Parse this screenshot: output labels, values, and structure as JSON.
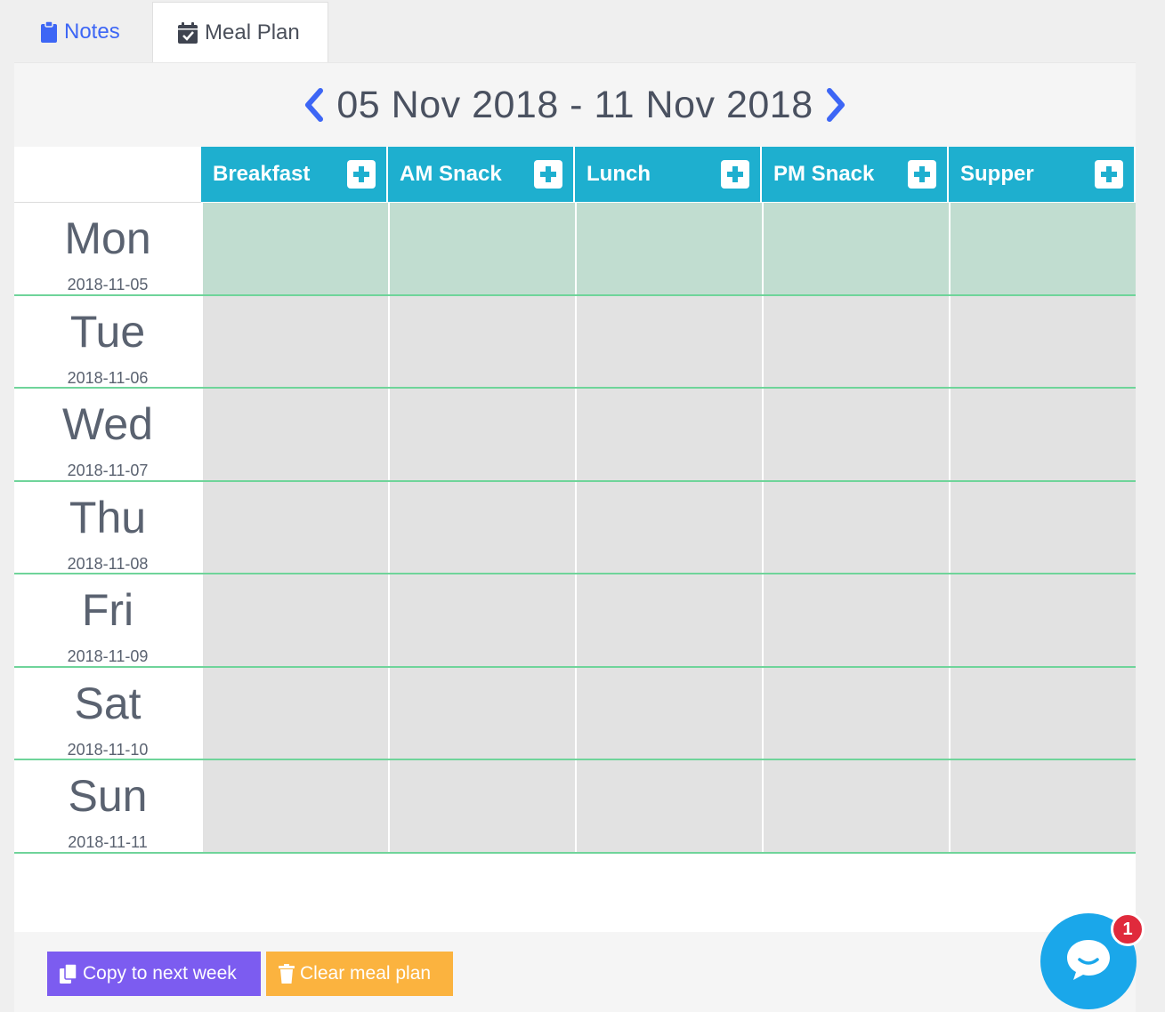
{
  "tabs": {
    "notes": {
      "label": "Notes",
      "icon": "clipboard-icon"
    },
    "meal_plan": {
      "label": "Meal Plan",
      "icon": "calendar-check-icon"
    }
  },
  "week": {
    "title": "05 Nov 2018 - 11 Nov 2018",
    "prev_icon": "chevron-left-icon",
    "next_icon": "chevron-right-icon"
  },
  "meals": [
    {
      "label": "Breakfast"
    },
    {
      "label": "AM Snack"
    },
    {
      "label": "Lunch"
    },
    {
      "label": "PM Snack"
    },
    {
      "label": "Supper"
    }
  ],
  "days": [
    {
      "name": "Mon",
      "date": "2018-11-05",
      "highlighted": true
    },
    {
      "name": "Tue",
      "date": "2018-11-06"
    },
    {
      "name": "Wed",
      "date": "2018-11-07"
    },
    {
      "name": "Thu",
      "date": "2018-11-08"
    },
    {
      "name": "Fri",
      "date": "2018-11-09"
    },
    {
      "name": "Sat",
      "date": "2018-11-10"
    },
    {
      "name": "Sun",
      "date": "2018-11-11"
    }
  ],
  "footer": {
    "copy_label": "Copy to next week",
    "clear_label": "Clear meal plan"
  },
  "chat": {
    "badge": "1",
    "icon": "chat-bubble-icon"
  },
  "colors": {
    "header_teal": "#1eafcf",
    "today_cell": "#c1ddd0",
    "cell": "#e2e2e2",
    "row_line": "#6fd49a",
    "copy_button": "#7c5cf0",
    "clear_button": "#fbb33f",
    "chat": "#1aa7ea",
    "badge": "#e02a3c",
    "link_blue": "#3d66f5"
  }
}
